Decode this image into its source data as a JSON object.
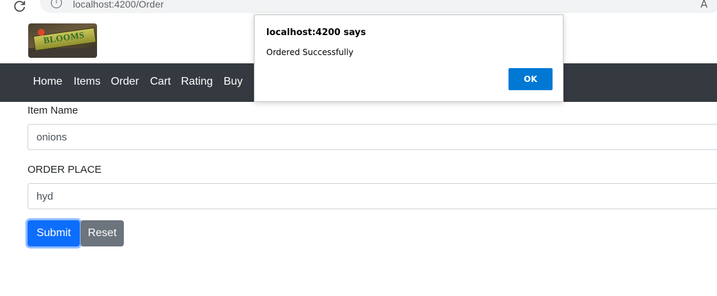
{
  "browser": {
    "url": "localhost:4200/Order",
    "info_icon": "i",
    "read_aloud_icon": "Ã"
  },
  "logo": {
    "text": "BLOOMS"
  },
  "nav": {
    "items": [
      {
        "label": "Home"
      },
      {
        "label": "Items"
      },
      {
        "label": "Order"
      },
      {
        "label": "Cart"
      },
      {
        "label": "Rating"
      },
      {
        "label": "Buy"
      }
    ]
  },
  "form": {
    "item_name_label": "Item Name",
    "item_name_value": "onions",
    "order_place_label": "ORDER PLACE",
    "order_place_value": "hyd",
    "submit_label": "Submit",
    "reset_label": "Reset"
  },
  "alert": {
    "title": "localhost:4200 says",
    "message": "Ordered Successfully",
    "ok_label": "OK"
  },
  "colors": {
    "navbar": "#343a40",
    "primary": "#0d6efd",
    "secondary": "#6c757d",
    "dialog_ok": "#0078d4"
  }
}
